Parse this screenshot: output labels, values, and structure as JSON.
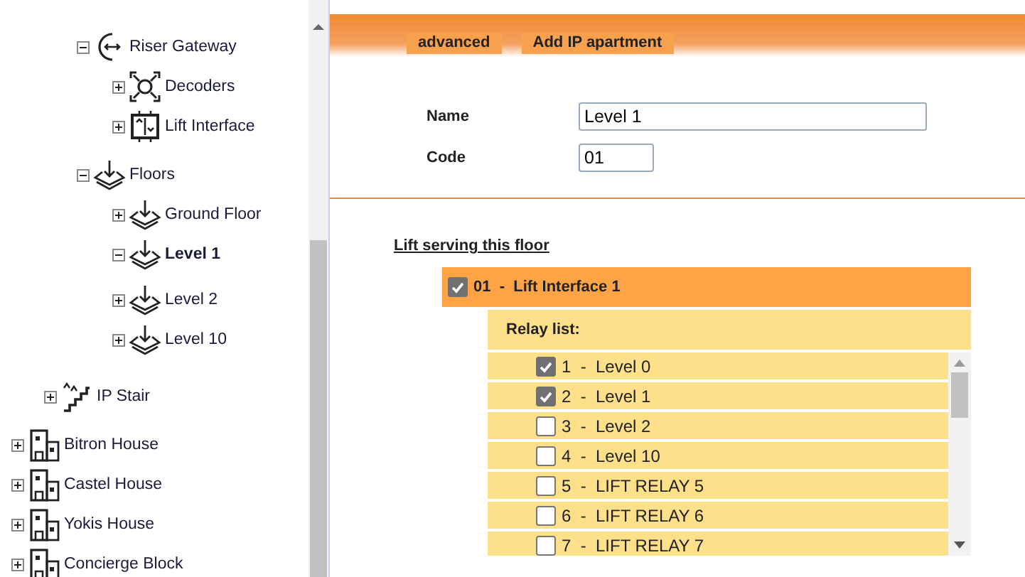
{
  "tree": {
    "items": [
      {
        "children": [
          {
            "children": [
              {
                "label": "Riser Gateway",
                "kind": "gateway",
                "expanded": true,
                "selected": false,
                "children": [
                  {
                    "label": "Decoders",
                    "kind": "decoder",
                    "expanded": false,
                    "selected": false
                  },
                  {
                    "label": "Lift Interface",
                    "kind": "lift",
                    "expanded": false,
                    "selected": false
                  }
                ]
              },
              {
                "label": "Floors",
                "kind": "floors",
                "expanded": true,
                "selected": false,
                "children": [
                  {
                    "label": "Ground Floor",
                    "kind": "floors",
                    "expanded": false,
                    "selected": false
                  },
                  {
                    "label": "Level 1",
                    "kind": "floors",
                    "expanded": true,
                    "selected": true
                  },
                  {
                    "label": "Level 2",
                    "kind": "floors",
                    "expanded": false,
                    "selected": false
                  },
                  {
                    "label": "Level 10",
                    "kind": "floors",
                    "expanded": false,
                    "selected": false
                  }
                ]
              }
            ]
          },
          {
            "label": "IP Stair",
            "kind": "stair",
            "expanded": false,
            "selected": false
          }
        ]
      },
      {
        "label": "Bitron House",
        "kind": "building",
        "expanded": false,
        "selected": false
      },
      {
        "label": "Castel House",
        "kind": "building",
        "expanded": false,
        "selected": false
      },
      {
        "label": "Yokis House",
        "kind": "building",
        "expanded": false,
        "selected": false
      },
      {
        "label": "Concierge Block",
        "kind": "building",
        "expanded": false,
        "selected": false
      }
    ]
  },
  "tabs": [
    {
      "label": "advanced"
    },
    {
      "label": "Add IP apartment"
    }
  ],
  "form": [
    {
      "label": "Name",
      "value": "Level 1",
      "kind": "wide"
    },
    {
      "label": "Code",
      "value": "01",
      "kind": "short"
    }
  ],
  "lift_section": {
    "title": "Lift serving this floor",
    "lift": {
      "label": "01  -  Lift Interface 1",
      "checked": true
    },
    "relay_title": "Relay list:",
    "relays": [
      {
        "label": "1  -  Level 0",
        "checked": true
      },
      {
        "label": "2  -  Level 1",
        "checked": true
      },
      {
        "label": "3  -  Level 2",
        "checked": false
      },
      {
        "label": "4  -  Level 10",
        "checked": false
      },
      {
        "label": "5  -  LIFT RELAY 5",
        "checked": false
      },
      {
        "label": "6  -  LIFT RELAY 6",
        "checked": false
      },
      {
        "label": "7  -  LIFT RELAY 7",
        "checked": false
      }
    ]
  }
}
